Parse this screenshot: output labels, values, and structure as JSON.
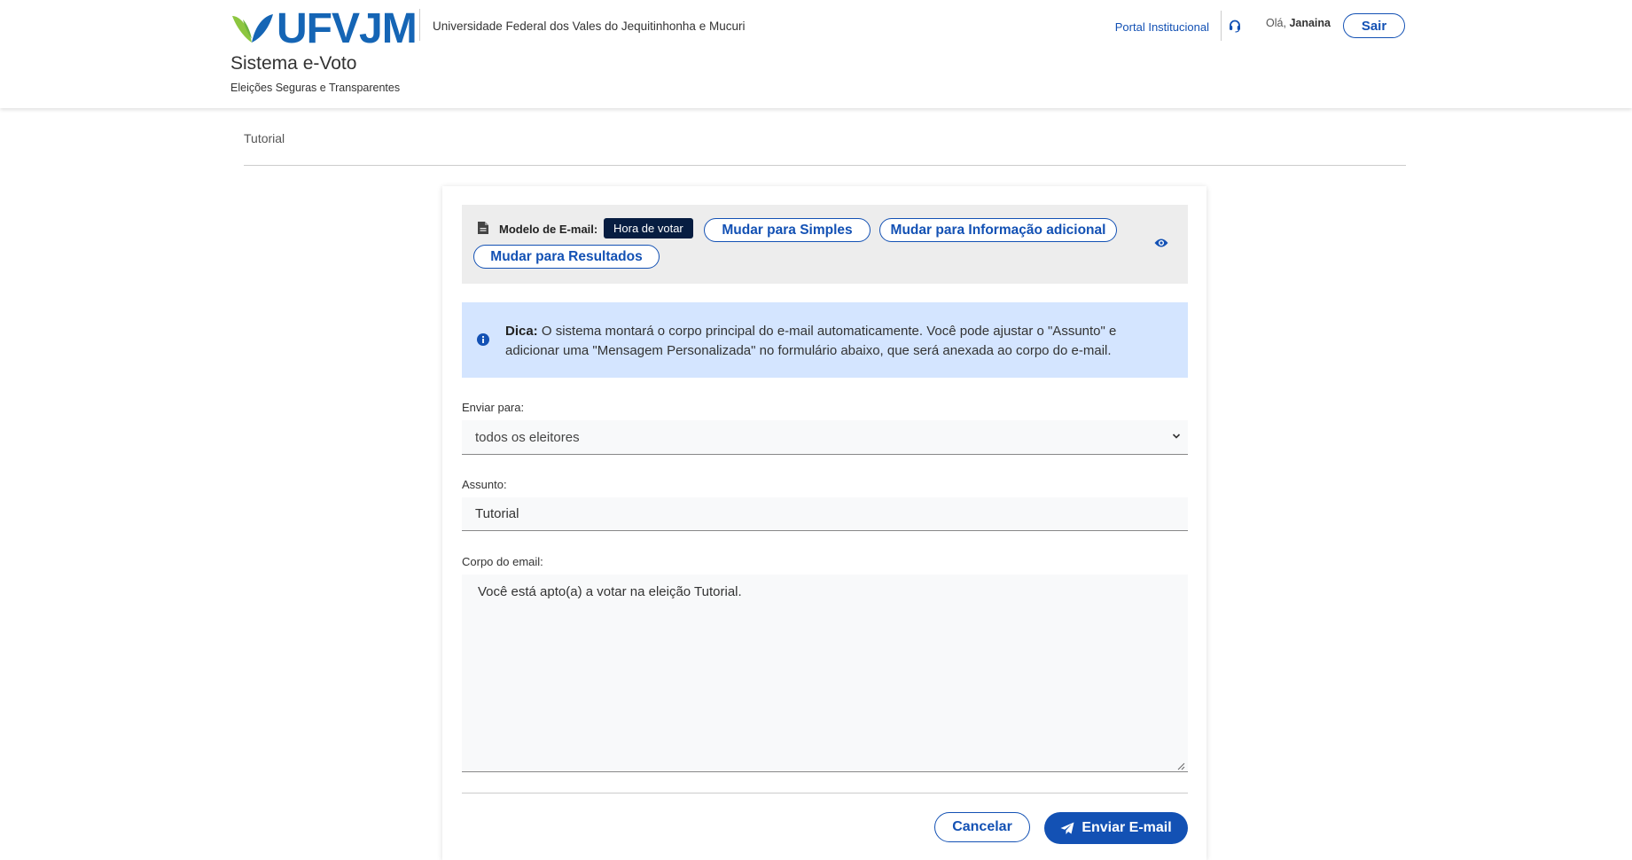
{
  "header": {
    "logo_text": "UFVJM",
    "university_name": "Universidade Federal dos Vales do Jequitinhonha e Mucuri",
    "system_title": "Sistema e-Voto",
    "system_subtitle": "Eleições Seguras e Transparentes",
    "portal_link": "Portal Institucional",
    "support_icon": "headset-icon",
    "greeting_prefix": "Olá,",
    "user_name": "Janaina",
    "logout_label": "Sair"
  },
  "breadcrumb": {
    "current": "Tutorial"
  },
  "template_bar": {
    "icon": "document-icon",
    "label": "Modelo de E-mail:",
    "active_template": "Hora de votar",
    "switch_buttons": [
      "Mudar para Simples",
      "Mudar para Informação adicional",
      "Mudar para Resultados"
    ],
    "preview_icon": "eye-icon"
  },
  "tip": {
    "icon": "info-icon",
    "label": "Dica:",
    "text": "O sistema montará o corpo principal do e-mail automaticamente. Você pode ajustar o \"Assunto\" e adicionar uma \"Mensagem Personalizada\" no formulário abaixo, que será anexada ao corpo do e-mail."
  },
  "form": {
    "send_to_label": "Enviar para:",
    "send_to_value": "todos os eleitores",
    "subject_label": "Assunto:",
    "subject_value": "Tutorial",
    "body_label": "Corpo do email:",
    "body_value": "Você está apto(a) a votar na eleição Tutorial."
  },
  "actions": {
    "cancel_label": "Cancelar",
    "send_label": "Enviar E-mail",
    "send_icon": "paper-plane-icon"
  },
  "colors": {
    "primary": "#1351b4",
    "dark_badge": "#071d41",
    "tip_bg": "#d4e5ff",
    "logo_blue": "#1565b5",
    "logo_green": "#8cc63f"
  }
}
